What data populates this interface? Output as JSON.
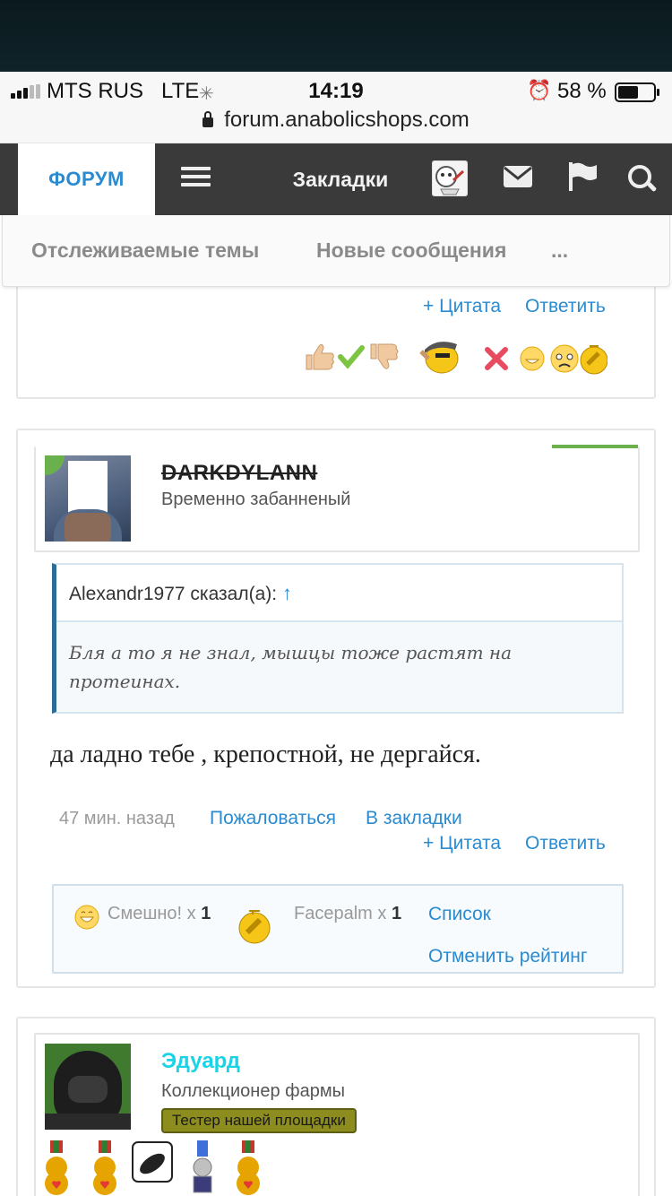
{
  "status_bar": {
    "carrier": "MTS RUS",
    "network": "LTE",
    "time": "14:19",
    "battery": "58 %",
    "battery_level": 0.58,
    "url": "forum.anabolicshops.com"
  },
  "nav": {
    "forum": "ФОРУМ",
    "bookmarks": "Закладки"
  },
  "subnav": {
    "watched": "Отслеживаемые темы",
    "new_posts": "Новые сообщения",
    "more": "..."
  },
  "prev_post": {
    "quote": "+ Цитата",
    "reply": "Ответить"
  },
  "post": {
    "username": "DARKDYLANN",
    "user_title": "Временно забанненый",
    "quote_author": "Alexandr1977 сказал(а):",
    "quote_arrow": "↑",
    "quote_text": "Бля а то я не знал, мышцы тоже растят на протеинах.",
    "text": "да ладно тебе , крепостной, не дергайся.",
    "time": "47 мин. назад",
    "report": "Пожаловаться",
    "bookmark": "В закладки",
    "quote": "+ Цитата",
    "reply": "Ответить",
    "ratings": [
      {
        "label": "Смешно!",
        "count_prefix": "x",
        "count": "1"
      },
      {
        "label": "Facepalm",
        "count_prefix": "x",
        "count": "1"
      }
    ],
    "list": "Список",
    "cancel_rating": "Отменить рейтинг"
  },
  "next_post": {
    "username": "Эдуард",
    "user_title": "Коллекционер фармы",
    "badge": "Тестер нашей площадки"
  },
  "colors": {
    "link": "#2a8bd0",
    "navbar": "#3a3a3a",
    "online": "#6ab04c",
    "username_next": "#19d3e6",
    "badge": "#8c8c1f"
  }
}
